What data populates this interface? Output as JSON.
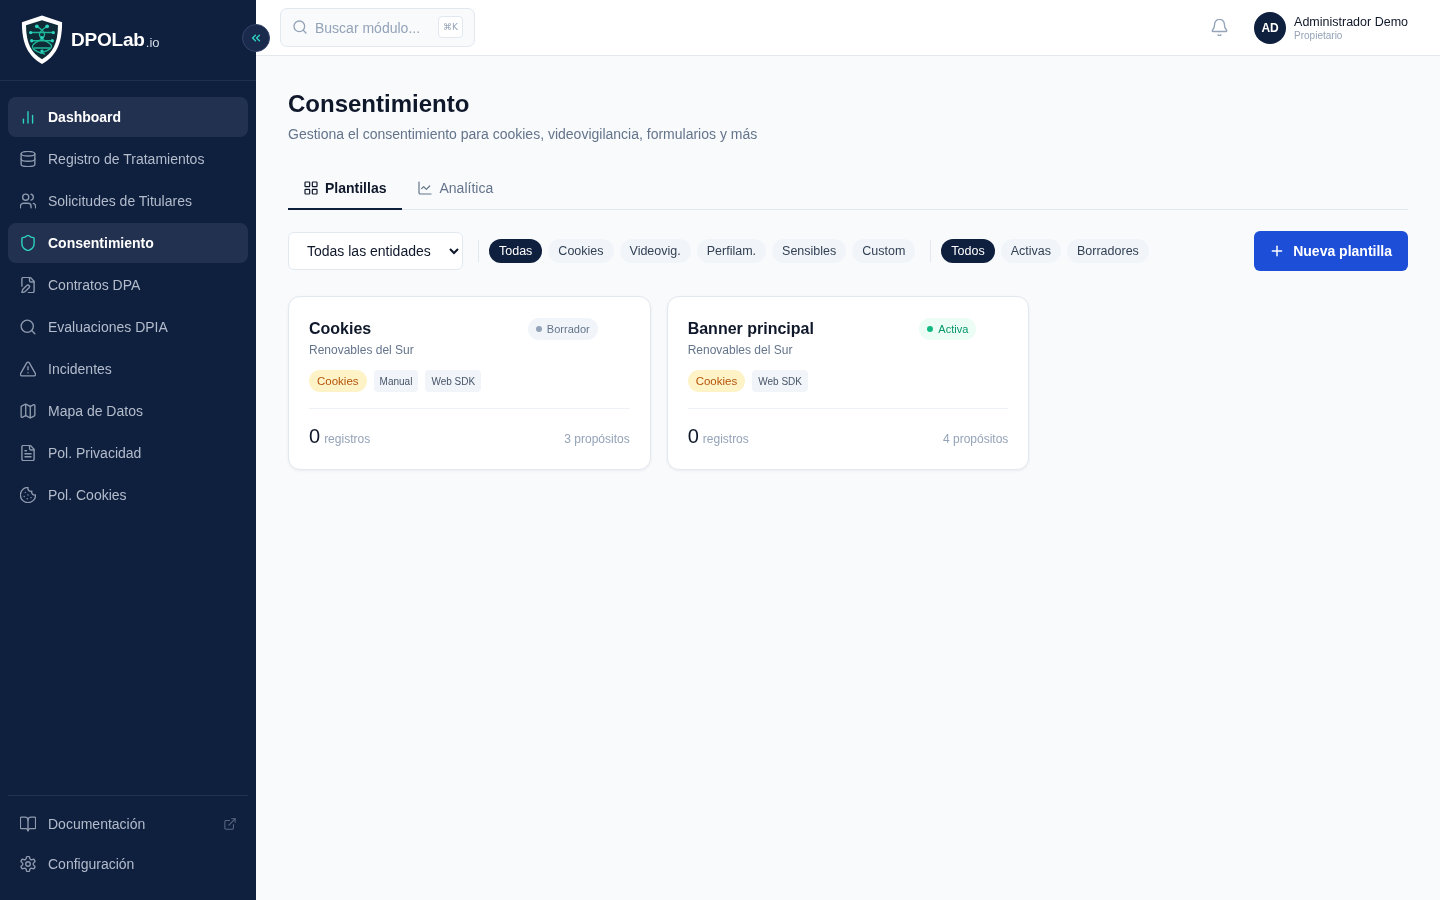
{
  "sidebar": {
    "brand": {
      "name": "DPOLab",
      "suffix": ".io"
    },
    "items": [
      {
        "label": "Dashboard",
        "selected": true
      },
      {
        "label": "Registro de Tratamientos",
        "selected": false
      },
      {
        "label": "Solicitudes de Titulares",
        "selected": false
      },
      {
        "label": "Consentimiento",
        "selected": true
      },
      {
        "label": "Contratos DPA",
        "selected": false
      },
      {
        "label": "Evaluaciones DPIA",
        "selected": false
      },
      {
        "label": "Incidentes",
        "selected": false
      },
      {
        "label": "Mapa de Datos",
        "selected": false
      },
      {
        "label": "Pol. Privacidad",
        "selected": false
      },
      {
        "label": "Pol. Cookies",
        "selected": false
      }
    ],
    "footer_items": [
      {
        "label": "Documentación",
        "external": true
      },
      {
        "label": "Configuración",
        "external": false
      }
    ]
  },
  "topbar": {
    "search": {
      "placeholder": "Buscar módulo...",
      "shortcut": "⌘K"
    },
    "user": {
      "initials": "AD",
      "name": "Administrador Demo",
      "role": "Propietario"
    }
  },
  "page": {
    "title": "Consentimiento",
    "subtitle": "Gestiona el consentimiento para cookies, videovigilancia, formularios y más"
  },
  "tabs": [
    {
      "label": "Plantillas",
      "selected": true
    },
    {
      "label": "Analítica",
      "selected": false
    }
  ],
  "filters": {
    "entity_select": "Todas las entidades",
    "types": [
      {
        "label": "Todas",
        "selected": true
      },
      {
        "label": "Cookies",
        "selected": false
      },
      {
        "label": "Videovig.",
        "selected": false
      },
      {
        "label": "Perfilam.",
        "selected": false
      },
      {
        "label": "Sensibles",
        "selected": false
      },
      {
        "label": "Custom",
        "selected": false
      }
    ],
    "statuses": [
      {
        "label": "Todos",
        "selected": true
      },
      {
        "label": "Activas",
        "selected": false
      },
      {
        "label": "Borradores",
        "selected": false
      }
    ]
  },
  "new_button": "Nueva plantilla",
  "cards": [
    {
      "title": "Cookies",
      "status": {
        "label": "Borrador",
        "kind": "draft"
      },
      "entity": "Renovables del Sur",
      "tags": [
        {
          "label": "Cookies",
          "kind": "category"
        },
        {
          "label": "Manual",
          "kind": "plain"
        },
        {
          "label": "Web SDK",
          "kind": "plain"
        }
      ],
      "count": "0",
      "count_label": "registros",
      "purposes": "3 propósitos"
    },
    {
      "title": "Banner principal",
      "status": {
        "label": "Activa",
        "kind": "active"
      },
      "entity": "Renovables del Sur",
      "tags": [
        {
          "label": "Cookies",
          "kind": "category"
        },
        {
          "label": "Web SDK",
          "kind": "plain"
        }
      ],
      "count": "0",
      "count_label": "registros",
      "purposes": "4 propósitos"
    }
  ]
}
